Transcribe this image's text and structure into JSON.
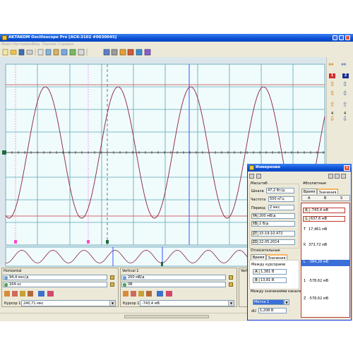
{
  "window": {
    "title": "AKTAKOM Oscilloscope Pro [ACK-3102 #0030045]"
  },
  "menu": [
    "Файл",
    "Настройки",
    "Вид",
    "Панели",
    "Справка"
  ],
  "right_panel": {
    "channel_1": "1",
    "channel_2": "2",
    "arrow_numbers": [
      "4",
      "4"
    ]
  },
  "horizontal_panel": {
    "header": "Horizontal",
    "timebase": "94,4 мкс/д",
    "offset": "164 нс",
    "cursor_label": "Курсор 1",
    "cursor_value": "240,71 мкс"
  },
  "vertical_panel": {
    "header": "Vertical 1",
    "scale": "200 мВ/д",
    "offset": "0В",
    "cursor_label": "Курсор 1",
    "cursor_value": "-743,4 мВ"
  },
  "vertical_panel_2": {
    "header": "Vertica"
  },
  "measurements_dialog": {
    "title": "Измерения",
    "scale_group": "Масштаб",
    "scale_label": "Шкала",
    "scale_value": "47,2 Вт/д",
    "freq_label": "Частота",
    "freq_value": "500 кГц",
    "period_label": "Период",
    "period_value": "2 мкс",
    "ya_label": "YA",
    "ya_value": "200 мВ/д",
    "yb_label": "YB",
    "yb_value": "2 В/д",
    "zt_label": "ZT",
    "zt_value": "15:19:10.472",
    "zd_label": "ZD",
    "zd_value": "22.05.2014",
    "relative_group": "Относительные",
    "rel_tab_time": "Время",
    "rel_tab_values": "Значения",
    "between_cursors": "Между курсорами",
    "a_label": "A",
    "a_value": "1,381 В",
    "b_label": "B",
    "b_value": "13,81 В",
    "between_channels": "Между значениями каналов:",
    "marker_select": "Метка 1",
    "du_label": "dU",
    "du_value": "1,208 В",
    "absolute_group": "Абсолютные",
    "abs_tab_time": "Время",
    "abs_tab_values": "Значения",
    "abs_cols": [
      "A",
      "B",
      "S"
    ],
    "k_label": "K",
    "k_value": "-743,4 мВ",
    "l_label": "L",
    "l_value": "637,6 мВ",
    "list": [
      {
        "key": "T",
        "value": "17,461 мВ"
      },
      {
        "key": "K",
        "value": "373,72 мВ"
      },
      {
        "key": "L",
        "value": "-384,28 мВ"
      },
      {
        "key": "1",
        "value": "-578,62 мВ"
      },
      {
        "key": "Z",
        "value": "-578,62 мВ"
      }
    ]
  },
  "colors": {
    "title_blue": "#0a4fd4",
    "plot_bg": "#f0fbfc",
    "grid_line": "#58a6b5",
    "grid_dot": "#8ec9d3",
    "wave_main": "#8a2040",
    "wave_lower": "#8a2040",
    "marker_magenta": "#ff49d2",
    "cursor_blue": "#3a50ff",
    "cursor_red": "#d26a6a",
    "trigger_green": "#1c6c3a"
  }
}
